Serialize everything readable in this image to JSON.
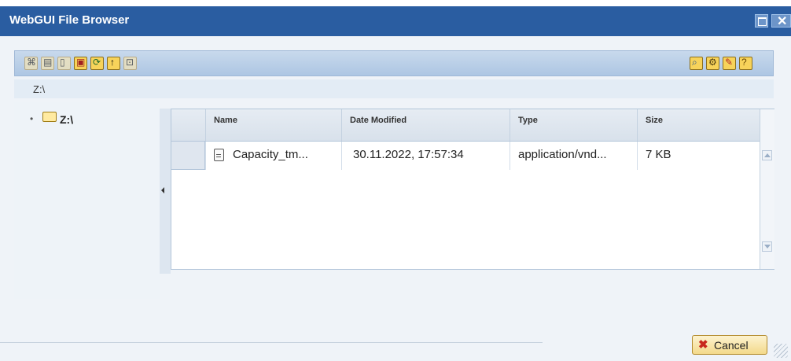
{
  "window": {
    "title": "WebGUI File Browser",
    "maximize_icon": "maximize-icon",
    "close_icon": "close-icon"
  },
  "toolbar": {
    "left_buttons": [
      {
        "icon": "new-folder-icon",
        "enabled": false
      },
      {
        "icon": "copy-icon",
        "enabled": false
      },
      {
        "icon": "delete-icon",
        "enabled": false
      },
      {
        "icon": "rename-icon",
        "enabled": true
      },
      {
        "icon": "refresh-icon",
        "enabled": true
      },
      {
        "icon": "up-directory-icon",
        "enabled": true
      },
      {
        "icon": "properties-icon",
        "enabled": false
      }
    ],
    "right_buttons": [
      {
        "icon": "search-icon"
      },
      {
        "icon": "settings-icon"
      },
      {
        "icon": "edit-icon"
      },
      {
        "icon": "help-icon"
      }
    ]
  },
  "path": {
    "current": "Z:\\"
  },
  "tree": {
    "root_label": "Z:\\"
  },
  "grid": {
    "columns": [
      "Name",
      "Date Modified",
      "Type",
      "Size"
    ],
    "rows": [
      {
        "name": "Capacity_tm...",
        "date_modified": "30.11.2022, 17:57:34",
        "type": "application/vnd...",
        "size": "7 KB"
      }
    ]
  },
  "footer": {
    "cancel_label": "Cancel"
  },
  "colors": {
    "title_bar": "#2a5da1",
    "toolbar": "#bcd0e8",
    "accent_button": "#f3d98a"
  }
}
